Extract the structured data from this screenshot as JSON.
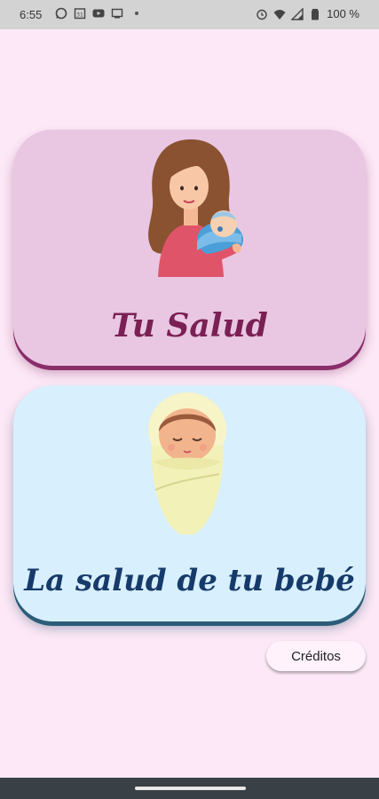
{
  "status_bar": {
    "time": "6:55",
    "left_icons": [
      "whatsapp-icon",
      "calendar-icon",
      "youtube-icon",
      "cast-icon"
    ],
    "right_icons": [
      "alarm-icon",
      "wifi-icon",
      "signal-icon",
      "battery-icon"
    ],
    "battery_percent": "100 %"
  },
  "cards": {
    "health": {
      "title": "Tu Salud",
      "illustration": "mother-holding-baby-illustration",
      "color": "#e9c7e3"
    },
    "baby": {
      "title": "La salud de tu bebé",
      "illustration": "swaddled-baby-illustration",
      "color": "#d8effd"
    }
  },
  "credits_button": {
    "label": "Créditos"
  },
  "colors": {
    "background": "#fce8f6",
    "health_accent": "#7a2054",
    "baby_accent": "#163a6a"
  }
}
